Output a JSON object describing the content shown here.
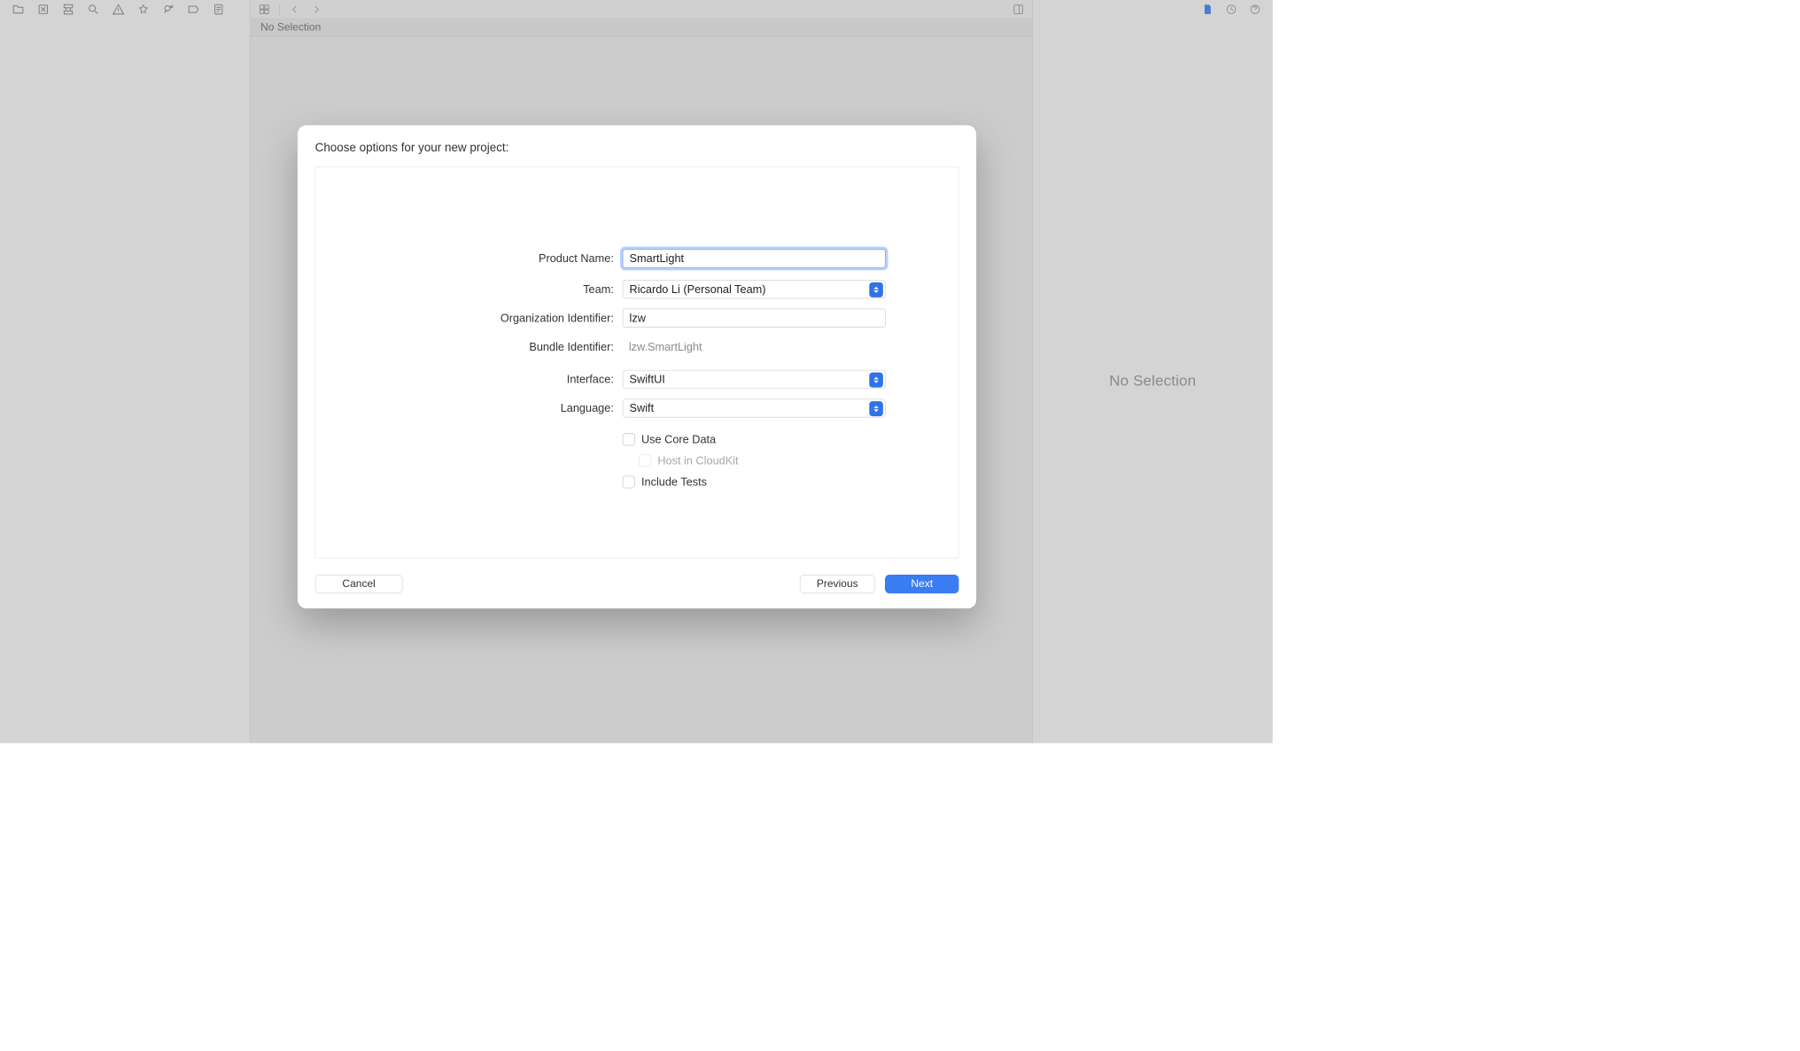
{
  "jumpbar": {
    "text": "No Selection"
  },
  "inspector": {
    "no_selection": "No Selection"
  },
  "modal": {
    "title": "Choose options for your new project:",
    "labels": {
      "product_name": "Product Name:",
      "team": "Team:",
      "org_id": "Organization Identifier:",
      "bundle_id": "Bundle Identifier:",
      "interface": "Interface:",
      "language": "Language:"
    },
    "values": {
      "product_name": "SmartLight",
      "team": "Ricardo Li (Personal Team)",
      "org_id": "lzw",
      "bundle_id": "lzw.SmartLight",
      "interface": "SwiftUI",
      "language": "Swift"
    },
    "checks": {
      "core_data": "Use Core Data",
      "cloudkit": "Host in CloudKit",
      "tests": "Include Tests"
    },
    "buttons": {
      "cancel": "Cancel",
      "previous": "Previous",
      "next": "Next"
    }
  }
}
